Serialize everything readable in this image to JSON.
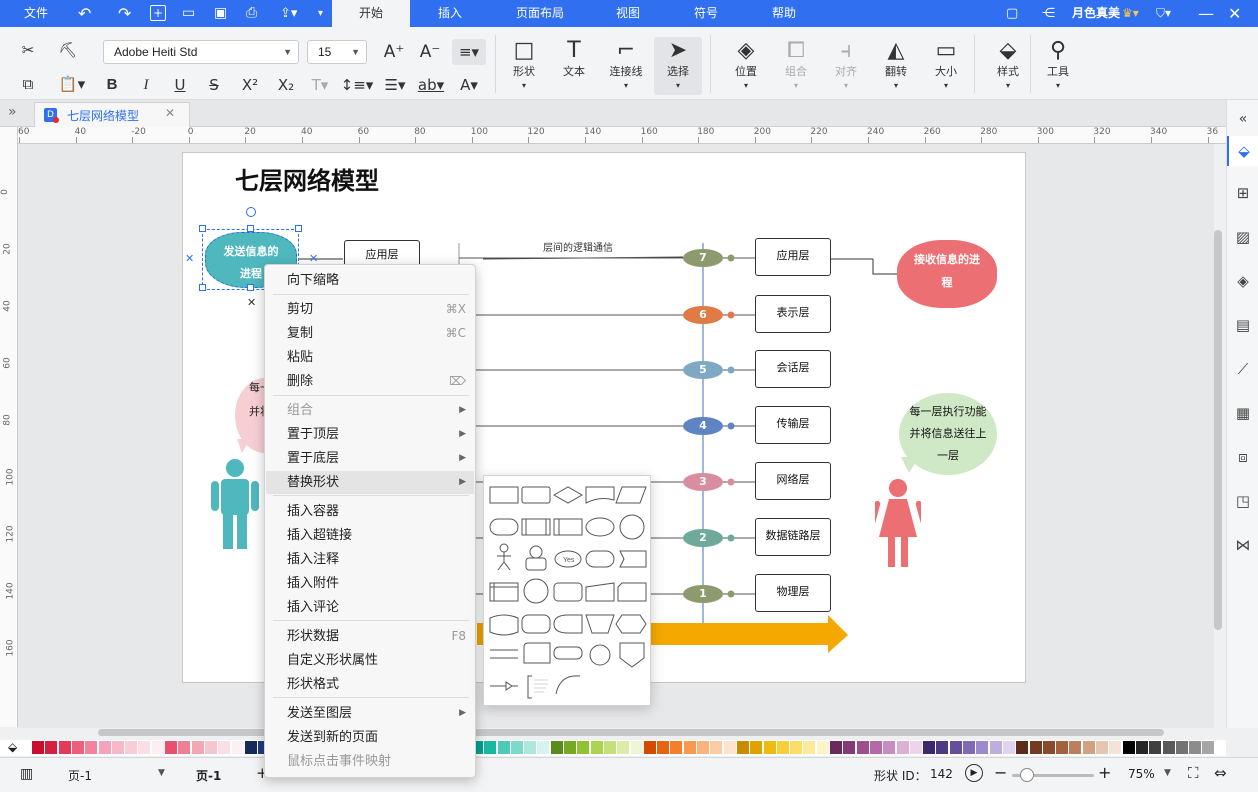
{
  "menu": {
    "file": "文件",
    "start": "开始",
    "insert": "插入",
    "layout": "页面布局",
    "view": "视图",
    "symbol": "符号",
    "help": "帮助",
    "user": "月色真美"
  },
  "font": {
    "family": "Adobe Heiti Std",
    "size": "15"
  },
  "tools": {
    "shape": "形状",
    "text": "文本",
    "connector": "连接线",
    "select": "选择",
    "position": "位置",
    "group": "组合",
    "align": "对齐",
    "flip": "翻转",
    "size": "大小",
    "style": "样式",
    "tools": "工具"
  },
  "doc": {
    "tab": "七层网络模型"
  },
  "ruler_h": [
    "60",
    "40",
    "-20",
    "0",
    "20",
    "40",
    "60",
    "80",
    "100",
    "120",
    "140",
    "160",
    "180",
    "200",
    "220",
    "240",
    "260",
    "280",
    "300",
    "320",
    "340",
    "36"
  ],
  "ruler_v": [
    "0",
    "20",
    "40",
    "60",
    "80",
    "100",
    "120",
    "140",
    "160"
  ],
  "diagram": {
    "title": "七层网络模型",
    "sender": "发送信息的进程",
    "receiver": "接收信息的进程",
    "left_top": "应用层",
    "logic": "层间的逻辑通信",
    "layers": [
      {
        "num": "7",
        "name": "应用层",
        "color": "#8c9a6e"
      },
      {
        "num": "6",
        "name": "表示层",
        "color": "#e07b45"
      },
      {
        "num": "5",
        "name": "会话层",
        "color": "#7fa8c4"
      },
      {
        "num": "4",
        "name": "传输层",
        "color": "#5f84c4"
      },
      {
        "num": "3",
        "name": "网络层",
        "color": "#d98ea0"
      },
      {
        "num": "2",
        "name": "数据链路层",
        "color": "#6fa99a"
      },
      {
        "num": "1",
        "name": "物理层",
        "color": "#8c9a6e"
      }
    ],
    "bubble_right": "每一层执行功能并将信息送往上一层",
    "bubble_left_1": "每一",
    "bubble_left_2": "并将"
  },
  "context_menu": {
    "items": [
      {
        "label": "向下缩略"
      },
      {
        "label": "剪切",
        "shortcut": "⌘X"
      },
      {
        "label": "复制",
        "shortcut": "⌘C"
      },
      {
        "label": "粘贴"
      },
      {
        "label": "删除",
        "shortcut": "⌦"
      },
      {
        "label": "组合"
      },
      {
        "label": "置于顶层"
      },
      {
        "label": "置于底层"
      },
      {
        "label": "替换形状"
      },
      {
        "label": "插入容器"
      },
      {
        "label": "插入超链接"
      },
      {
        "label": "插入注释"
      },
      {
        "label": "插入附件"
      },
      {
        "label": "插入评论"
      },
      {
        "label": "形状数据",
        "shortcut": "F8"
      },
      {
        "label": "自定义形状属性"
      },
      {
        "label": "形状格式"
      },
      {
        "label": "发送至图层"
      },
      {
        "label": "发送到新的页面"
      },
      {
        "label": "鼠标点击事件映射"
      }
    ]
  },
  "submenu": {
    "yes": "Yes"
  },
  "status": {
    "page_select": "页-1",
    "page_tab": "页-1",
    "shape_id_label": "形状 ID：",
    "shape_id": "142",
    "zoom": "75%"
  }
}
